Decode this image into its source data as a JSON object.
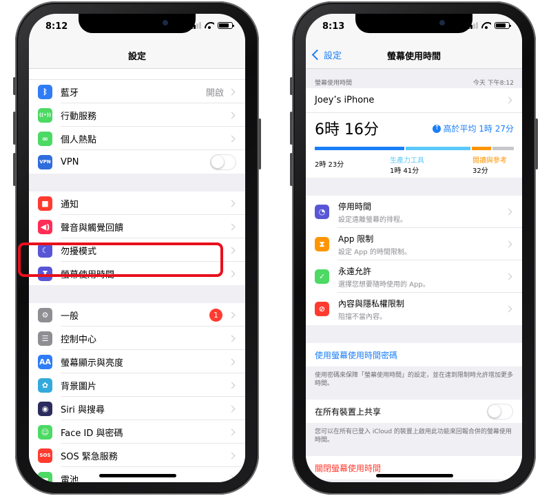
{
  "left_phone": {
    "status_time": "8:12",
    "nav_title": "設定",
    "groups": [
      [
        {
          "label": "藍牙",
          "value": "開啟",
          "icon": "bluetooth-icon",
          "color": "#2f7cf6",
          "glyph": "ᛒ",
          "accessory": "chevron"
        },
        {
          "label": "行動服務",
          "icon": "antenna-icon",
          "color": "#4cd964",
          "glyph": "((•))",
          "accessory": "chevron"
        },
        {
          "label": "個人熱點",
          "icon": "hotspot-icon",
          "color": "#4cd964",
          "glyph": "∞",
          "accessory": "chevron"
        },
        {
          "label": "VPN",
          "icon": "vpn-icon",
          "color": "#2f6cdc",
          "glyph": "VPN",
          "accessory": "toggle"
        }
      ],
      [
        {
          "label": "通知",
          "icon": "notifications-icon",
          "color": "#ff3b30",
          "glyph": "■",
          "accessory": "chevron"
        },
        {
          "label": "聲音與觸覺回饋",
          "icon": "speaker-icon",
          "color": "#ff2d55",
          "glyph": "◀)",
          "accessory": "chevron"
        },
        {
          "label": "勿擾模式",
          "icon": "moon-icon",
          "color": "#5856d6",
          "glyph": "☾",
          "accessory": "chevron"
        },
        {
          "label": "螢幕使用時間",
          "icon": "hourglass-icon",
          "color": "#5856d6",
          "glyph": "⧗",
          "accessory": "chevron"
        }
      ],
      [
        {
          "label": "一般",
          "icon": "gear-icon",
          "color": "#8e8e93",
          "glyph": "⚙",
          "accessory": "badge",
          "badge": "1"
        },
        {
          "label": "控制中心",
          "icon": "control-center-icon",
          "color": "#8e8e93",
          "glyph": "☰",
          "accessory": "chevron"
        },
        {
          "label": "螢幕顯示與亮度",
          "icon": "display-icon",
          "color": "#2f7cf6",
          "glyph": "AA",
          "accessory": "chevron"
        },
        {
          "label": "背景圖片",
          "icon": "wallpaper-icon",
          "color": "#34aadc",
          "glyph": "✿",
          "accessory": "chevron"
        },
        {
          "label": "Siri 與搜尋",
          "icon": "siri-icon",
          "color": "#2b2b5e",
          "glyph": "◉",
          "accessory": "chevron"
        },
        {
          "label": "Face ID 與密碼",
          "icon": "faceid-icon",
          "color": "#4cd964",
          "glyph": "☺",
          "accessory": "chevron"
        },
        {
          "label": "SOS 緊急服務",
          "icon": "sos-icon",
          "color": "#ff3b30",
          "glyph": "SOS",
          "accessory": "chevron"
        },
        {
          "label": "電池",
          "icon": "battery-setting-icon",
          "color": "#4cd964",
          "glyph": "▬",
          "accessory": "chevron"
        }
      ]
    ]
  },
  "right_phone": {
    "status_time": "8:13",
    "back_label": "設定",
    "nav_title": "螢幕使用時間",
    "section_label": "螢幕使用時間",
    "section_date": "今天 下午8:12",
    "device_name": "Joey’s iPhone",
    "total_time": "6時 16分",
    "avg_label": "高於平均 1時 27分",
    "categories": [
      {
        "name": "",
        "time": "2時 23分",
        "color": "#1a7ef7",
        "fraction": 0.46
      },
      {
        "name": "生產力工具",
        "time": "1時 41分",
        "color": "#5ac8fa",
        "fraction": 0.33
      },
      {
        "name": "閱讀與參考",
        "time": "32分",
        "color": "#ff9500",
        "fraction": 0.1
      },
      {
        "name": "",
        "time": "",
        "color": "#c7c7cc",
        "fraction": 0.11
      }
    ],
    "settings": [
      {
        "title": "停用時間",
        "subtitle": "設定遠離螢幕的排程。",
        "icon": "downtime-icon",
        "color": "#5856d6",
        "glyph": "◔"
      },
      {
        "title": "App 限制",
        "subtitle": "設定 App 的時間限制。",
        "icon": "app-limits-icon",
        "color": "#ff9500",
        "glyph": "⧗"
      },
      {
        "title": "永遠允許",
        "subtitle": "選擇您想要隨時使用的 App。",
        "icon": "always-allowed-icon",
        "color": "#4cd964",
        "glyph": "✓"
      },
      {
        "title": "內容與隱私權限制",
        "subtitle": "阻擋不當內容。",
        "icon": "restrictions-icon",
        "color": "#ff3b30",
        "glyph": "⊘"
      }
    ],
    "passcode_link": "使用螢幕使用時間密碼",
    "passcode_footer": "使用密碼來保障「螢幕使用時間」的設定，並在達到限制時允許增加更多時間。",
    "share_label": "在所有裝置上共享",
    "share_footer": "您可以在所有已登入 iCloud 的裝置上啟用此功能來回報合併的螢幕使用時間。",
    "turn_off_link": "關閉螢幕使用時間"
  }
}
